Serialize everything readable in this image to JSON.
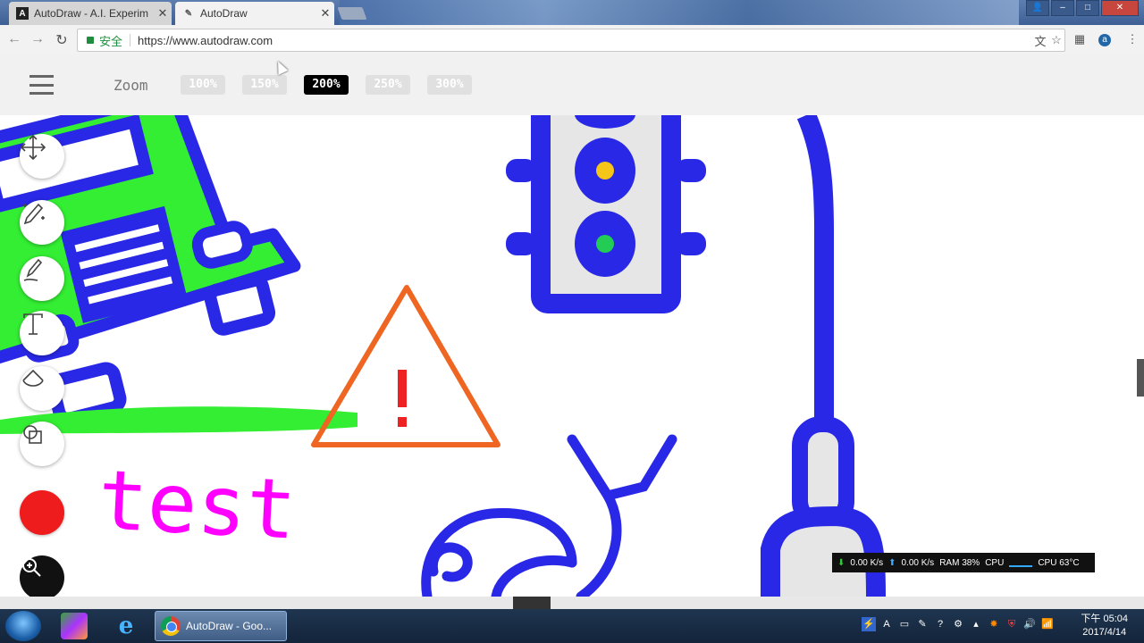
{
  "browser": {
    "tabs": [
      {
        "title": "AutoDraw - A.I. Experim",
        "favicon": "A"
      },
      {
        "title": "AutoDraw",
        "favicon": "pencil-icon"
      }
    ],
    "secure_label": "安全",
    "url": "https://www.autodraw.com"
  },
  "app": {
    "zoom_label": "Zoom",
    "zoom_options": [
      "100%",
      "150%",
      "200%",
      "250%",
      "300%"
    ],
    "zoom_selected": "200%",
    "canvas_text": "test",
    "colors": {
      "blue": "#2828e6",
      "green": "#33ee33",
      "magenta": "#ff00ff",
      "orange": "#ee6622",
      "red": "#ee2222",
      "yellow": "#f5c518",
      "light_green": "#22cc55",
      "gray": "#e6e6e6",
      "selected_color": "#ee1c1c"
    }
  },
  "overlay": {
    "download": "0.00 K/s",
    "upload": "0.00 K/s",
    "ram": "RAM 38%",
    "cpu_label": "CPU",
    "cpu_temp": "CPU 63°C"
  },
  "taskbar": {
    "task_label": "AutoDraw - Goo...",
    "time": "下午 05:04",
    "date": "2017/4/14"
  }
}
